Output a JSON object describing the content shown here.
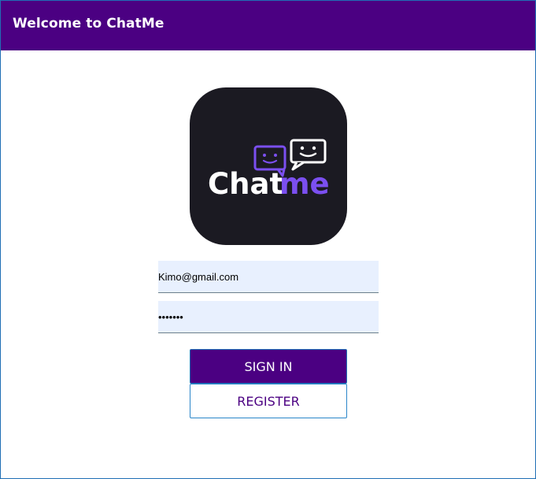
{
  "header": {
    "title": "Welcome to ChatMe"
  },
  "logo": {
    "text_prefix": "Chat",
    "text_suffix": "me",
    "icon": "chat-bubbles-icon"
  },
  "form": {
    "email_value": "Kimo@gmail.com",
    "password_value": "•••••••"
  },
  "buttons": {
    "signin_label": "SIGN IN",
    "register_label": "REGISTER"
  },
  "colors": {
    "primary": "#4b0082",
    "logo_bg": "#1b1a22",
    "logo_accent": "#7b4ff0",
    "input_bg": "#e8f0fe"
  }
}
